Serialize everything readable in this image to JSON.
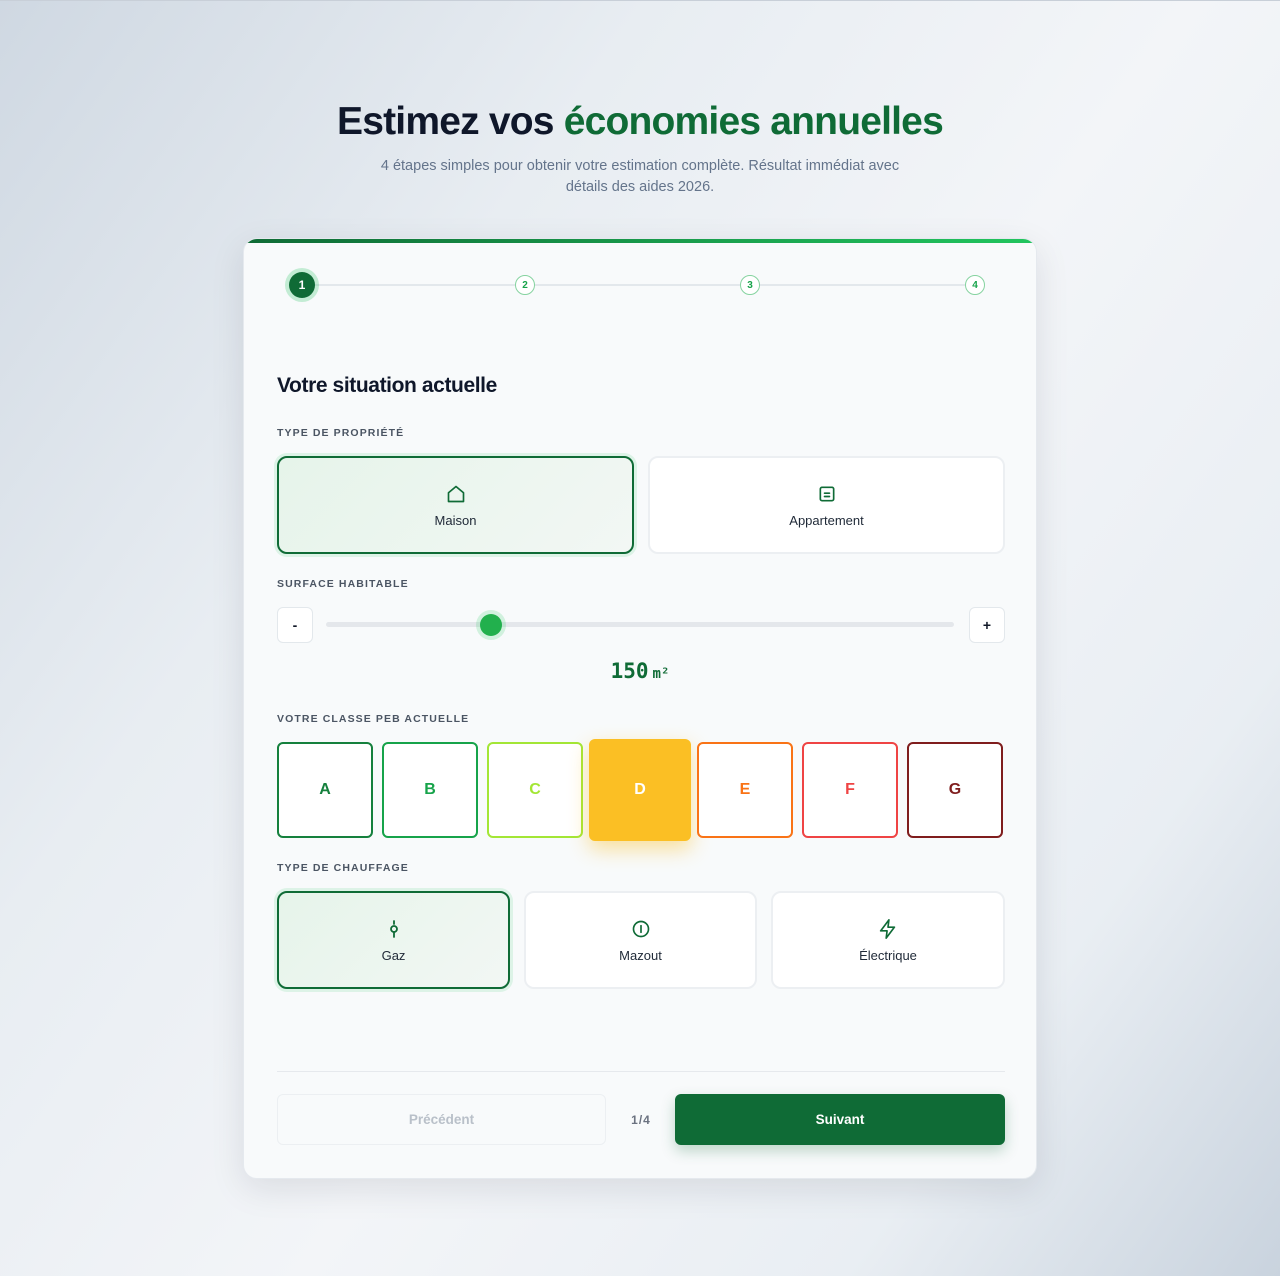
{
  "hero": {
    "title_part1": "Estimez vos ",
    "title_accent": "économies annuelles",
    "subtitle": "4 étapes simples pour obtenir votre estimation complète. Résultat immédiat avec détails des aides 2026."
  },
  "stepper": {
    "steps": [
      "1",
      "2",
      "3",
      "4"
    ],
    "current": 1
  },
  "section": {
    "title": "Votre situation actuelle"
  },
  "property": {
    "label": "TYPE DE PROPRIÉTÉ",
    "options": [
      {
        "label": "Maison",
        "icon": "house-icon",
        "selected": true
      },
      {
        "label": "Appartement",
        "icon": "building-icon",
        "selected": false
      }
    ]
  },
  "surface": {
    "label": "SURFACE HABITABLE",
    "minus_label": "-",
    "plus_label": "+",
    "value": "150",
    "unit": "m²",
    "slider_fraction": 0.262
  },
  "peb": {
    "label": "VOTRE CLASSE PEB ACTUELLE",
    "selected": "D",
    "classes": [
      {
        "letter": "A",
        "color": "#15803d"
      },
      {
        "letter": "B",
        "color": "#16a34a"
      },
      {
        "letter": "C",
        "color": "#a3e635"
      },
      {
        "letter": "D",
        "color": "#fbbf24"
      },
      {
        "letter": "E",
        "color": "#f97316"
      },
      {
        "letter": "F",
        "color": "#ef4444"
      },
      {
        "letter": "G",
        "color": "#7f1d1d"
      }
    ]
  },
  "heating": {
    "label": "TYPE DE CHAUFFAGE",
    "options": [
      {
        "label": "Gaz",
        "icon": "gas-flame-icon",
        "selected": true
      },
      {
        "label": "Mazout",
        "icon": "oil-drop-icon",
        "selected": false
      },
      {
        "label": "Électrique",
        "icon": "lightning-icon",
        "selected": false
      }
    ]
  },
  "nav": {
    "prev_label": "Précédent",
    "counter": "1/4",
    "next_label": "Suivant"
  },
  "colors": {
    "primary": "#0f6b36",
    "accent": "#22c55e"
  }
}
